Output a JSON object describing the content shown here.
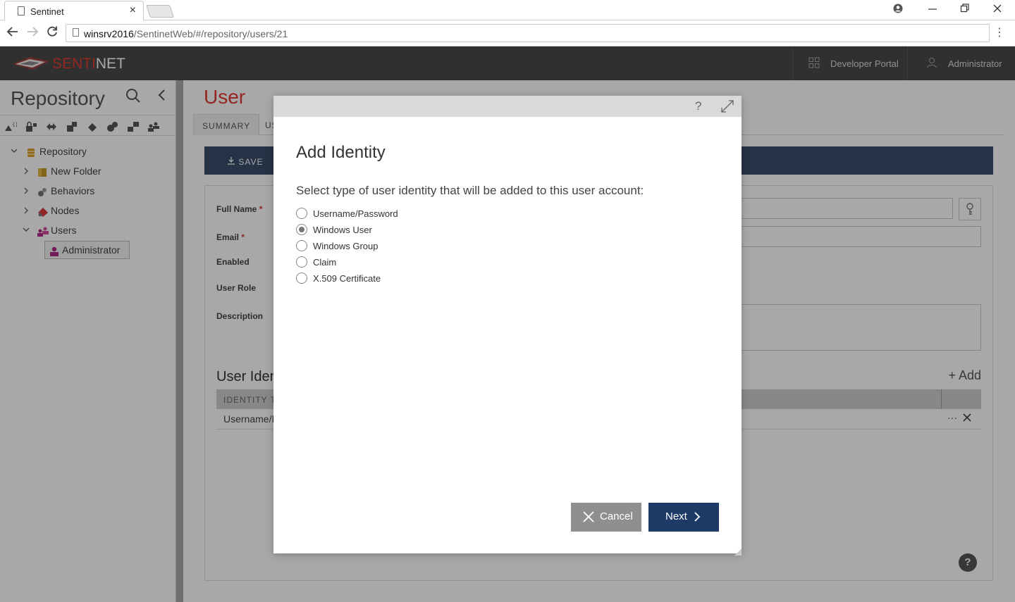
{
  "browser": {
    "tab_title": "Sentinet",
    "url_host": "winsrv2016",
    "url_path": "/SentinetWeb/#/repository/users/21"
  },
  "header": {
    "logo_part1": "SENTI",
    "logo_part2": "NET",
    "developer_portal": "Developer Portal",
    "user": "Administrator"
  },
  "left_panel": {
    "title": "Repository",
    "tree": [
      {
        "label": "Repository"
      },
      {
        "label": "New Folder"
      },
      {
        "label": "Behaviors"
      },
      {
        "label": "Nodes"
      },
      {
        "label": "Users"
      },
      {
        "label": "Administrator"
      }
    ]
  },
  "main": {
    "page_title": "User",
    "tabs": [
      "SUMMARY",
      "US"
    ],
    "save_label": "SAVE",
    "fields": {
      "full_name": "Full Name",
      "email": "Email",
      "enabled": "Enabled",
      "user_role": "User Role",
      "description": "Description",
      "required_mark": "*"
    },
    "section_title": "User Iden",
    "add_label": "+ Add",
    "grid_header": "IDENTITY TY",
    "grid_row": "Username/I",
    "help": "?"
  },
  "modal": {
    "help": "?",
    "title": "Add Identity",
    "prompt": "Select type of user identity that will be added to this user account:",
    "options": [
      {
        "label": "Username/Password",
        "checked": false
      },
      {
        "label": "Windows User",
        "checked": true
      },
      {
        "label": "Windows Group",
        "checked": false
      },
      {
        "label": "Claim",
        "checked": false
      },
      {
        "label": "X.509 Certificate",
        "checked": false
      }
    ],
    "cancel_label": "Cancel",
    "next_label": "Next"
  },
  "colors": {
    "brand_red": "#e03c31",
    "appbar": "#4a4a4a",
    "primary_button": "#1e3a66",
    "cancel_button": "#8f8f8f",
    "savebar": "#3a4e6b"
  }
}
